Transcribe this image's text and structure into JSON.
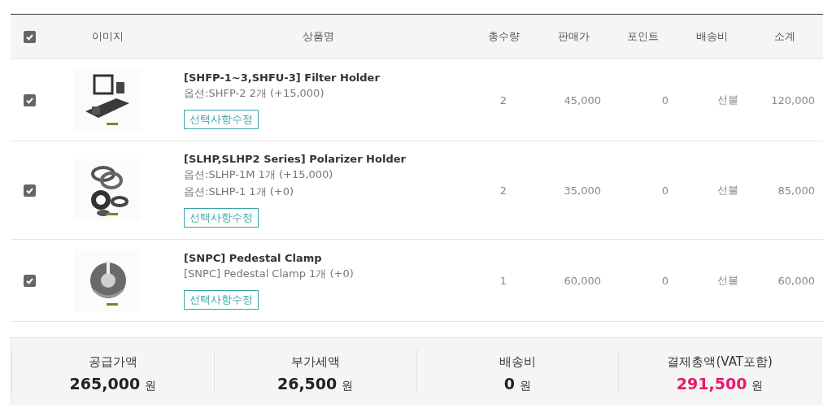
{
  "header": {
    "select_all": {
      "checked": true
    },
    "columns": [
      "이미지",
      "상품명",
      "총수량",
      "판매가",
      "포인트",
      "배송비",
      "소계"
    ]
  },
  "items": [
    {
      "checked": true,
      "image": {
        "kind": "picture"
      },
      "name": "[SHFP-1~3,SHFU-3] Filter Holder",
      "options": [
        "옵션:SHFP-2 2개 (+15,000)"
      ],
      "edit_button": "선택사항수정",
      "quantity": "2",
      "price": "45,000",
      "points": "0",
      "shipping": "선불",
      "subtotal": "120,000"
    },
    {
      "checked": true,
      "image": {
        "kind": "picture"
      },
      "name": "[SLHP,SLHP2 Series] Polarizer Holder",
      "options": [
        "옵션:SLHP-1M 1개 (+15,000)",
        "옵션:SLHP-1 1개 (+0)"
      ],
      "edit_button": "선택사항수정",
      "quantity": "2",
      "price": "35,000",
      "points": "0",
      "shipping": "선불",
      "subtotal": "85,000"
    },
    {
      "checked": true,
      "image": {
        "kind": "picture"
      },
      "name": "[SNPC] Pedestal Clamp",
      "options": [
        "[SNPC] Pedestal Clamp 1개 (+0)"
      ],
      "edit_button": "선택사항수정",
      "quantity": "1",
      "price": "60,000",
      "points": "0",
      "shipping": "선불",
      "subtotal": "60,000"
    }
  ],
  "summary": [
    {
      "label": "공급가액",
      "amount": "265,000",
      "unit": "원",
      "emphasis": false
    },
    {
      "label": "부가세액",
      "amount": "26,500",
      "unit": "원",
      "emphasis": false
    },
    {
      "label": "배송비",
      "amount": "0",
      "unit": "원",
      "emphasis": false
    },
    {
      "label": "결제총액(VAT포함)",
      "amount": "291,500",
      "unit": "원",
      "emphasis": true
    }
  ]
}
